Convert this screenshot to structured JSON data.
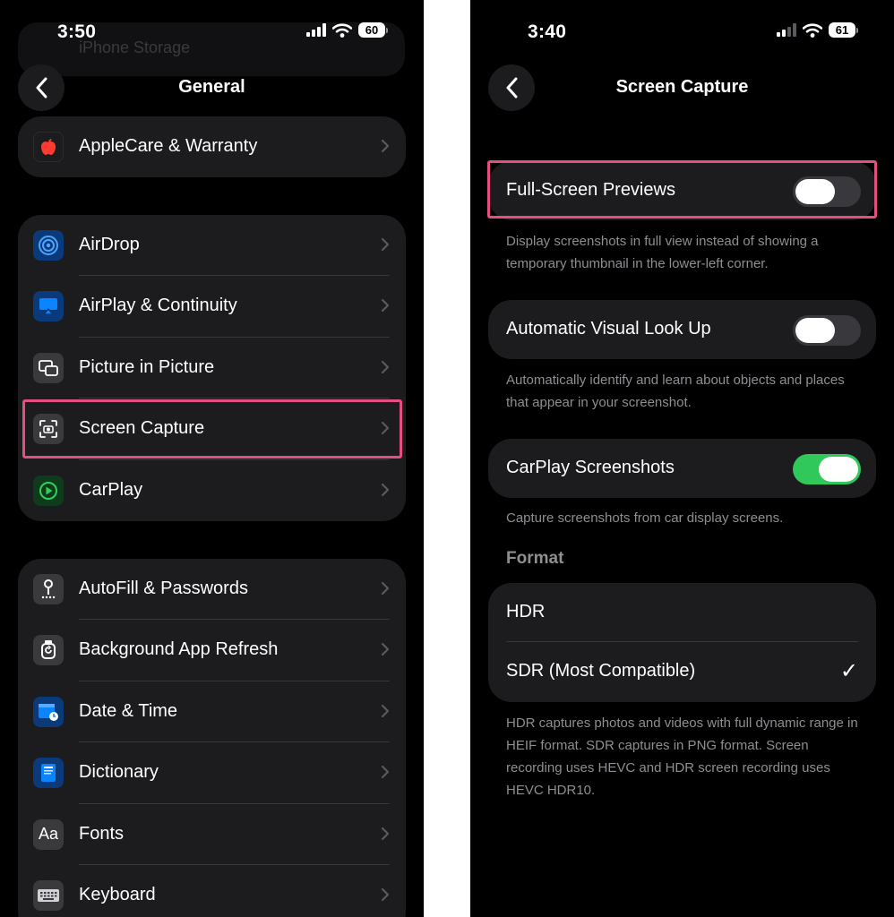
{
  "left_screen": {
    "status": {
      "time": "3:50",
      "battery": "60"
    },
    "partial_row_label": "iPhone Storage",
    "nav_title": "General",
    "group1": [
      {
        "label": "AppleCare & Warranty",
        "icon": "apple-logo-icon",
        "color": "#1c1c1e"
      }
    ],
    "group2": [
      {
        "label": "AirDrop",
        "icon": "airdrop-icon",
        "color": "#0a84ff"
      },
      {
        "label": "AirPlay & Continuity",
        "icon": "airplay-icon",
        "color": "#0a84ff"
      },
      {
        "label": "Picture in Picture",
        "icon": "picture-in-picture-icon",
        "color": "#3a3a3c"
      },
      {
        "label": "Screen Capture",
        "icon": "camera-viewfinder-icon",
        "color": "#3a3a3c"
      },
      {
        "label": "CarPlay",
        "icon": "carplay-icon",
        "color": "#30d158"
      }
    ],
    "group3": [
      {
        "label": "AutoFill & Passwords",
        "icon": "key-icon",
        "color": "#3a3a3c"
      },
      {
        "label": "Background App Refresh",
        "icon": "refresh-icon",
        "color": "#3a3a3c"
      },
      {
        "label": "Date & Time",
        "icon": "calendar-clock-icon",
        "color": "#0a84ff"
      },
      {
        "label": "Dictionary",
        "icon": "book-icon",
        "color": "#0a84ff"
      },
      {
        "label": "Fonts",
        "icon": "fonts-icon",
        "color": "#3a3a3c",
        "glyph": "Aa"
      },
      {
        "label": "Keyboard",
        "icon": "keyboard-icon",
        "color": "#3a3a3c"
      }
    ]
  },
  "right_screen": {
    "status": {
      "time": "3:40",
      "battery": "61"
    },
    "nav_title": "Screen Capture",
    "full_screen_previews": {
      "label": "Full-Screen Previews",
      "enabled": false,
      "footer": "Display screenshots in full view instead of showing a temporary thumbnail in the lower-left corner."
    },
    "visual_look_up": {
      "label": "Automatic Visual Look Up",
      "enabled": false,
      "footer": "Automatically identify and learn about objects and places that appear in your screenshot."
    },
    "carplay_screenshots": {
      "label": "CarPlay Screenshots",
      "enabled": true,
      "footer": "Capture screenshots from car display screens."
    },
    "format": {
      "header": "Format",
      "options": [
        {
          "label": "HDR",
          "selected": false
        },
        {
          "label": "SDR (Most Compatible)",
          "selected": true
        }
      ],
      "checkmark": "✓",
      "footer": "HDR captures photos and videos with full dynamic range in HEIF format. SDR captures in PNG format. Screen recording uses HEVC and HDR screen recording uses HEVC HDR10."
    }
  },
  "colors": {
    "highlight": "#e44f7f",
    "toggle_on": "#30c85a",
    "cell_background": "#1c1c1e"
  }
}
